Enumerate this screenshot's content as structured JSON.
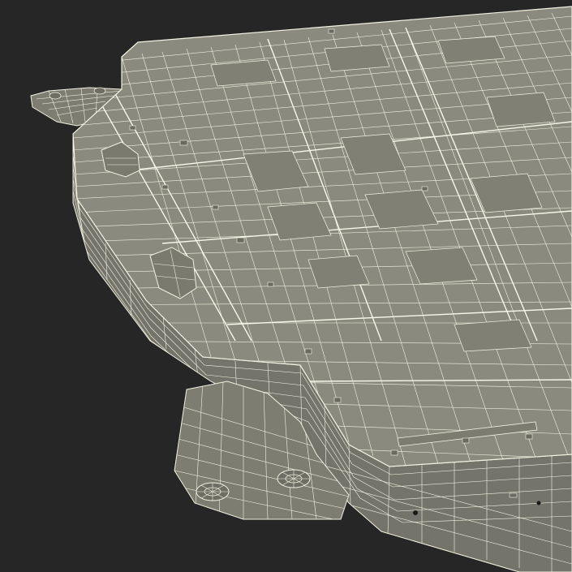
{
  "scene": {
    "subject": "battery-pack-wireframe",
    "background_color": "#262626",
    "surface_color": "#8a8a7e",
    "side_color": "#74746a",
    "wire_color": "#f2f2e2"
  }
}
